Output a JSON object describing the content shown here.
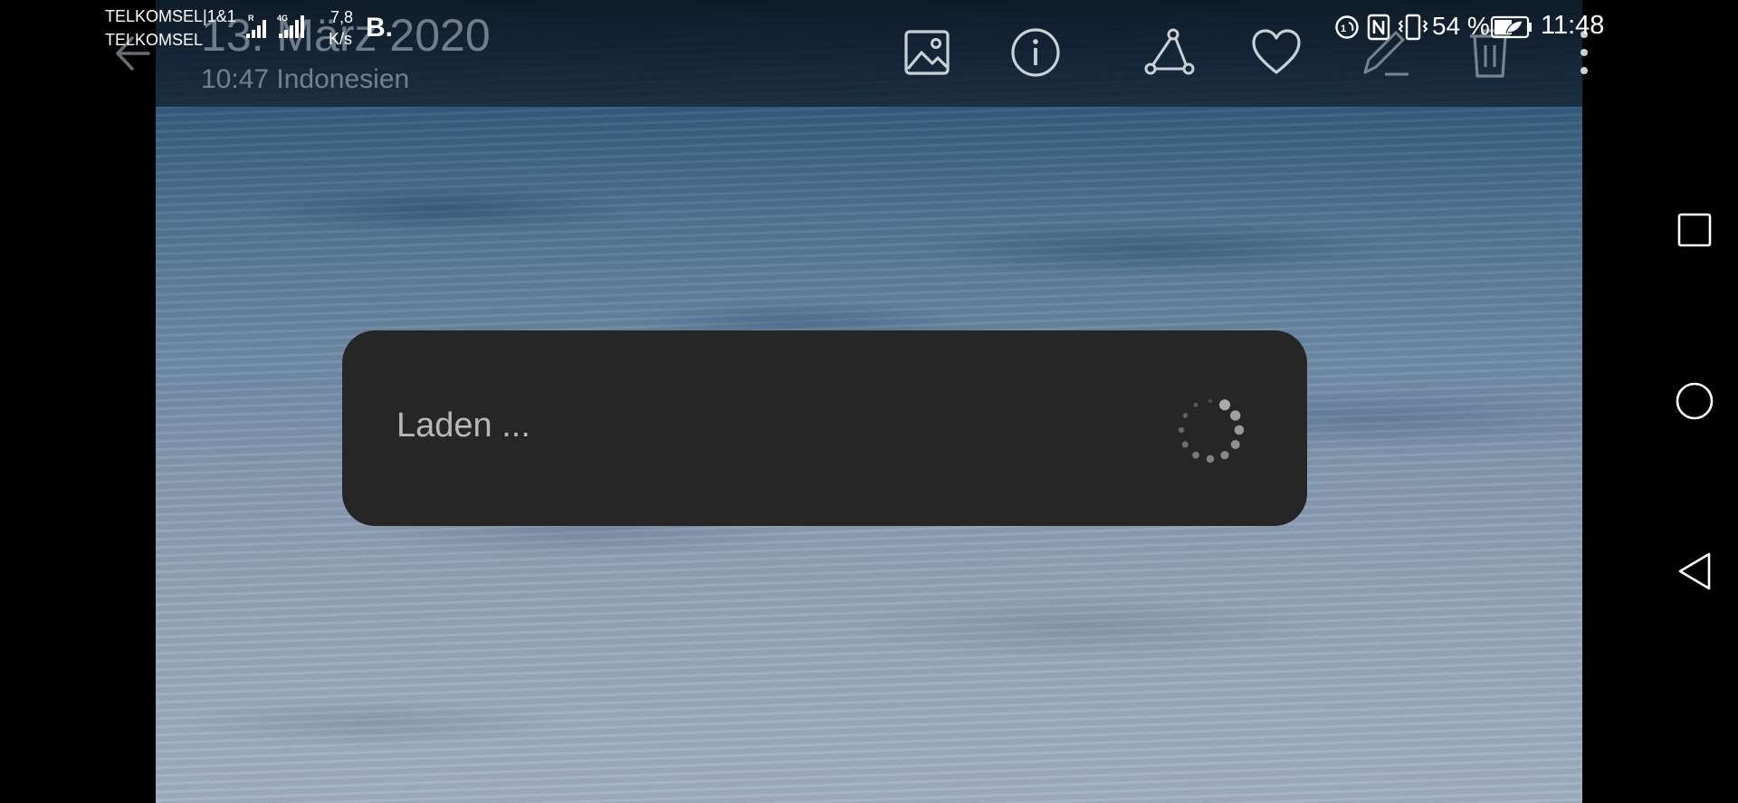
{
  "status_bar": {
    "carrier_line1": "TELKOMSEL|1&1",
    "carrier_line2": "TELKOMSEL",
    "network_speed_value": "7,8",
    "network_speed_unit": "K/s",
    "app_notification_label": "B.",
    "battery_percent": "54 %",
    "time": "11:48"
  },
  "header": {
    "date": "13. März 2020",
    "subtitle": "10:47 Indonesien"
  },
  "toolbar": {
    "icons": [
      "image-icon",
      "info-icon",
      "share-icon",
      "heart-icon",
      "edit-icon",
      "delete-icon",
      "more-icon"
    ]
  },
  "dialog": {
    "loading_text": "Laden ..."
  },
  "nav_bar": {
    "buttons": [
      "recents-button",
      "home-button",
      "back-button"
    ]
  }
}
